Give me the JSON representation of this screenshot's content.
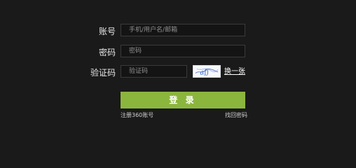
{
  "form": {
    "account": {
      "label": "账号",
      "placeholder": "手机/用户名/邮箱"
    },
    "password": {
      "label": "密码",
      "placeholder": "密码"
    },
    "captcha": {
      "label": "验证码",
      "placeholder": "验证码",
      "image_text": "afj",
      "refresh_label": "换一张"
    },
    "submit_label": "登 录",
    "register_link": "注册360账号",
    "forgot_link": "找回密码"
  }
}
